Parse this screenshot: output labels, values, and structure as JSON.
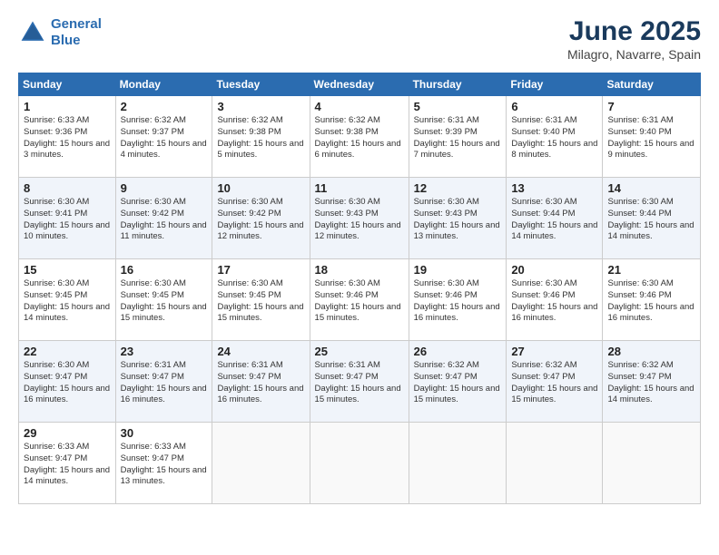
{
  "header": {
    "logo_line1": "General",
    "logo_line2": "Blue",
    "title": "June 2025",
    "subtitle": "Milagro, Navarre, Spain"
  },
  "calendar": {
    "columns": [
      "Sunday",
      "Monday",
      "Tuesday",
      "Wednesday",
      "Thursday",
      "Friday",
      "Saturday"
    ],
    "rows": [
      [
        {
          "day": "1",
          "sunrise": "6:33 AM",
          "sunset": "9:36 PM",
          "daylight": "15 hours and 3 minutes."
        },
        {
          "day": "2",
          "sunrise": "6:32 AM",
          "sunset": "9:37 PM",
          "daylight": "15 hours and 4 minutes."
        },
        {
          "day": "3",
          "sunrise": "6:32 AM",
          "sunset": "9:38 PM",
          "daylight": "15 hours and 5 minutes."
        },
        {
          "day": "4",
          "sunrise": "6:32 AM",
          "sunset": "9:38 PM",
          "daylight": "15 hours and 6 minutes."
        },
        {
          "day": "5",
          "sunrise": "6:31 AM",
          "sunset": "9:39 PM",
          "daylight": "15 hours and 7 minutes."
        },
        {
          "day": "6",
          "sunrise": "6:31 AM",
          "sunset": "9:40 PM",
          "daylight": "15 hours and 8 minutes."
        },
        {
          "day": "7",
          "sunrise": "6:31 AM",
          "sunset": "9:40 PM",
          "daylight": "15 hours and 9 minutes."
        }
      ],
      [
        {
          "day": "8",
          "sunrise": "6:30 AM",
          "sunset": "9:41 PM",
          "daylight": "15 hours and 10 minutes."
        },
        {
          "day": "9",
          "sunrise": "6:30 AM",
          "sunset": "9:42 PM",
          "daylight": "15 hours and 11 minutes."
        },
        {
          "day": "10",
          "sunrise": "6:30 AM",
          "sunset": "9:42 PM",
          "daylight": "15 hours and 12 minutes."
        },
        {
          "day": "11",
          "sunrise": "6:30 AM",
          "sunset": "9:43 PM",
          "daylight": "15 hours and 12 minutes."
        },
        {
          "day": "12",
          "sunrise": "6:30 AM",
          "sunset": "9:43 PM",
          "daylight": "15 hours and 13 minutes."
        },
        {
          "day": "13",
          "sunrise": "6:30 AM",
          "sunset": "9:44 PM",
          "daylight": "15 hours and 14 minutes."
        },
        {
          "day": "14",
          "sunrise": "6:30 AM",
          "sunset": "9:44 PM",
          "daylight": "15 hours and 14 minutes."
        }
      ],
      [
        {
          "day": "15",
          "sunrise": "6:30 AM",
          "sunset": "9:45 PM",
          "daylight": "15 hours and 14 minutes."
        },
        {
          "day": "16",
          "sunrise": "6:30 AM",
          "sunset": "9:45 PM",
          "daylight": "15 hours and 15 minutes."
        },
        {
          "day": "17",
          "sunrise": "6:30 AM",
          "sunset": "9:45 PM",
          "daylight": "15 hours and 15 minutes."
        },
        {
          "day": "18",
          "sunrise": "6:30 AM",
          "sunset": "9:46 PM",
          "daylight": "15 hours and 15 minutes."
        },
        {
          "day": "19",
          "sunrise": "6:30 AM",
          "sunset": "9:46 PM",
          "daylight": "15 hours and 16 minutes."
        },
        {
          "day": "20",
          "sunrise": "6:30 AM",
          "sunset": "9:46 PM",
          "daylight": "15 hours and 16 minutes."
        },
        {
          "day": "21",
          "sunrise": "6:30 AM",
          "sunset": "9:46 PM",
          "daylight": "15 hours and 16 minutes."
        }
      ],
      [
        {
          "day": "22",
          "sunrise": "6:30 AM",
          "sunset": "9:47 PM",
          "daylight": "15 hours and 16 minutes."
        },
        {
          "day": "23",
          "sunrise": "6:31 AM",
          "sunset": "9:47 PM",
          "daylight": "15 hours and 16 minutes."
        },
        {
          "day": "24",
          "sunrise": "6:31 AM",
          "sunset": "9:47 PM",
          "daylight": "15 hours and 16 minutes."
        },
        {
          "day": "25",
          "sunrise": "6:31 AM",
          "sunset": "9:47 PM",
          "daylight": "15 hours and 15 minutes."
        },
        {
          "day": "26",
          "sunrise": "6:32 AM",
          "sunset": "9:47 PM",
          "daylight": "15 hours and 15 minutes."
        },
        {
          "day": "27",
          "sunrise": "6:32 AM",
          "sunset": "9:47 PM",
          "daylight": "15 hours and 15 minutes."
        },
        {
          "day": "28",
          "sunrise": "6:32 AM",
          "sunset": "9:47 PM",
          "daylight": "15 hours and 14 minutes."
        }
      ],
      [
        {
          "day": "29",
          "sunrise": "6:33 AM",
          "sunset": "9:47 PM",
          "daylight": "15 hours and 14 minutes."
        },
        {
          "day": "30",
          "sunrise": "6:33 AM",
          "sunset": "9:47 PM",
          "daylight": "15 hours and 13 minutes."
        },
        null,
        null,
        null,
        null,
        null
      ]
    ]
  }
}
